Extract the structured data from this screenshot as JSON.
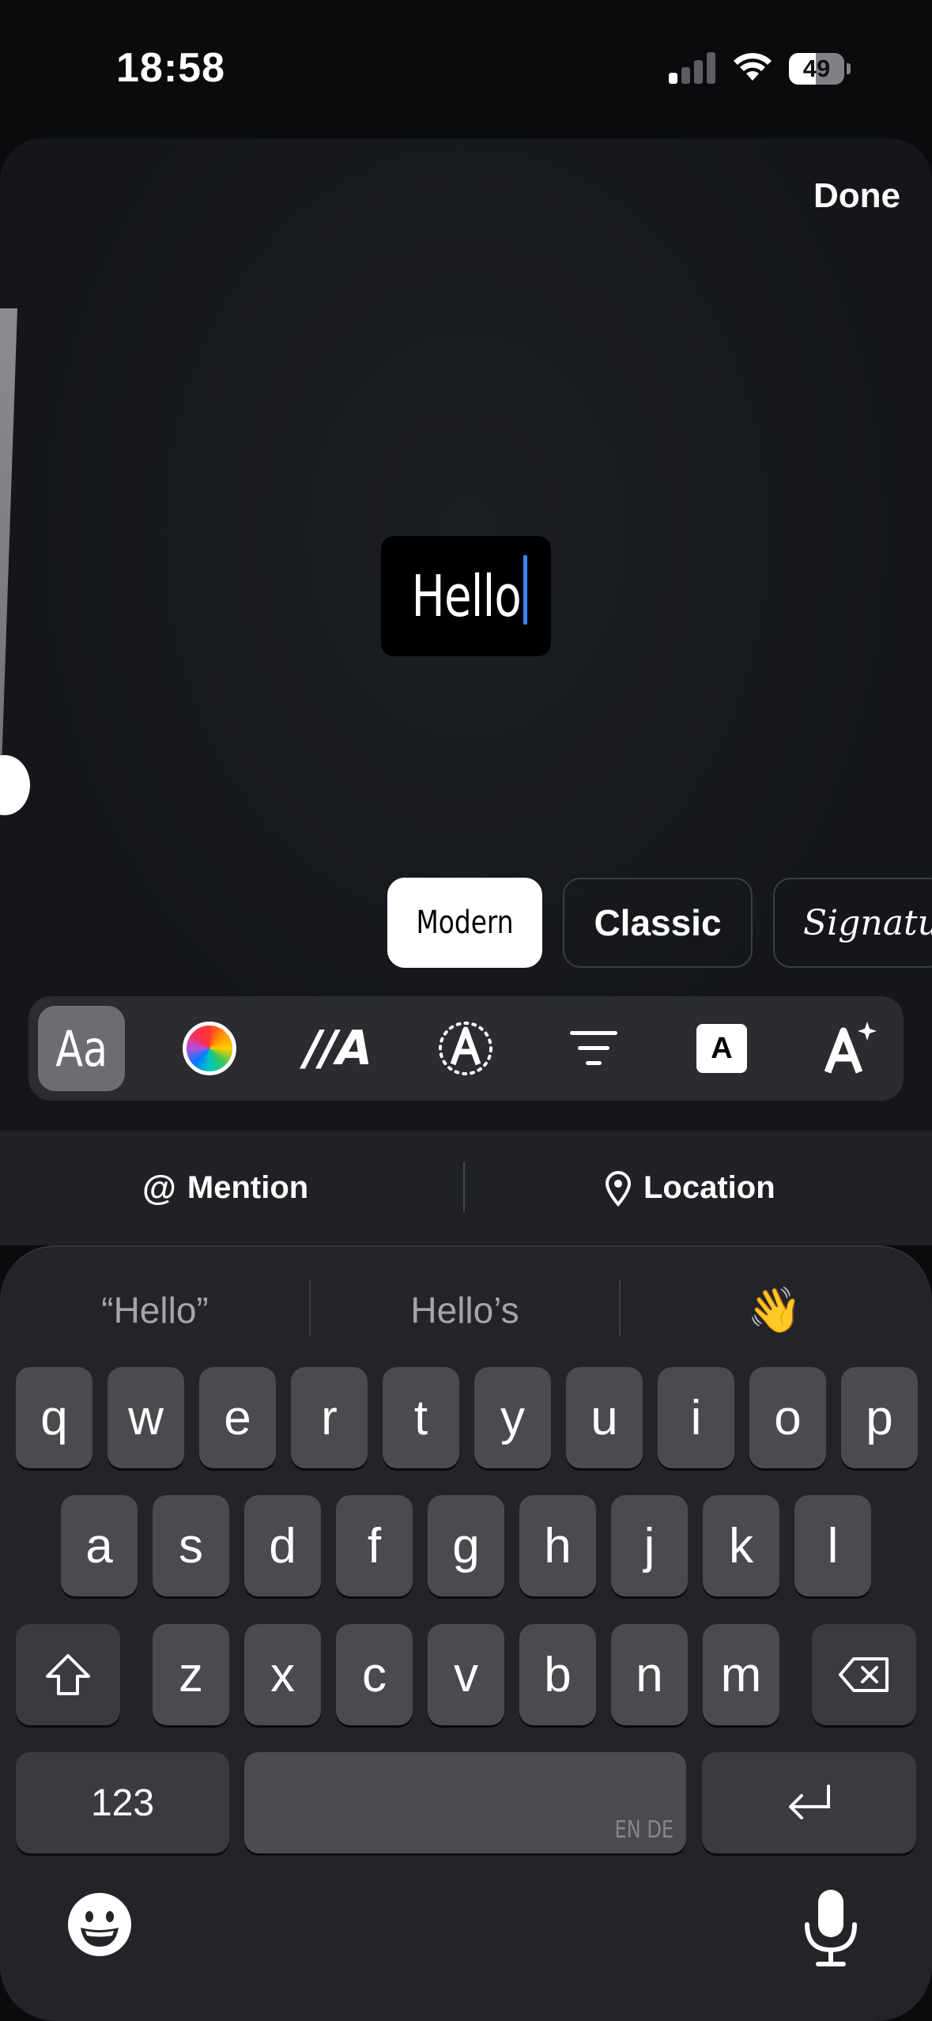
{
  "status_bar": {
    "time": "18:58",
    "battery": "49",
    "battery_level": 0.49
  },
  "editor": {
    "done_label": "Done",
    "text": "Hello",
    "font_styles": [
      {
        "label": "Modern",
        "selected": true
      },
      {
        "label": "Classic",
        "selected": false
      },
      {
        "label": "Signatur",
        "selected": false
      }
    ],
    "tools": {
      "font": "Aa",
      "color": "color-wheel-icon",
      "animate": "//A",
      "effect": "sparkle-outline-a-icon",
      "align": "align-center-icon",
      "background": "A",
      "ai_style": "a-sparkle-icon"
    }
  },
  "tag_bar": {
    "mention_label": "Mention",
    "location_label": "Location"
  },
  "keyboard": {
    "predictions": [
      "“Hello”",
      "Hello’s",
      "👋"
    ],
    "row1": [
      "q",
      "w",
      "e",
      "r",
      "t",
      "y",
      "u",
      "i",
      "o",
      "p"
    ],
    "row2": [
      "a",
      "s",
      "d",
      "f",
      "g",
      "h",
      "j",
      "k",
      "l"
    ],
    "row3": [
      "z",
      "x",
      "c",
      "v",
      "b",
      "n",
      "m"
    ],
    "numbers_label": "123",
    "space_languages": "EN DE"
  }
}
